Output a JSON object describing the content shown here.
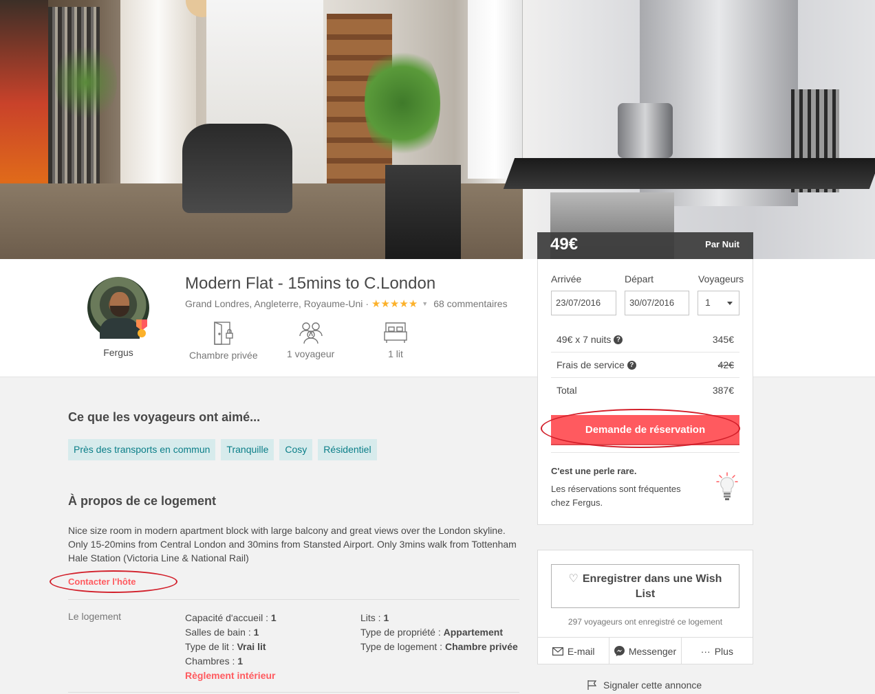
{
  "price": {
    "amount": "49€",
    "unit": "Par Nuit"
  },
  "host": {
    "name": "Fergus"
  },
  "listing": {
    "title": "Modern Flat - 15mins to C.London",
    "location": "Grand Londres, Angleterre, Royaume-Uni",
    "separator": "·",
    "rating_stars": "★★★★★",
    "rating_value": 5,
    "reviews": "68 commentaires"
  },
  "amenities": [
    {
      "icon": "private-room-icon",
      "label": "Chambre privée"
    },
    {
      "icon": "guests-icon",
      "label": "1 voyageur"
    },
    {
      "icon": "bed-icon",
      "label": "1 lit"
    }
  ],
  "booking": {
    "checkin_label": "Arrivée",
    "checkout_label": "Départ",
    "guests_label": "Voyageurs",
    "checkin_value": "23/07/2016",
    "checkout_value": "30/07/2016",
    "guests_value": "1",
    "rows": [
      {
        "label": "49€ x 7 nuits",
        "value": "345€",
        "help": "?"
      },
      {
        "label": "Frais de service",
        "value": "42€",
        "help": "?"
      },
      {
        "label": "Total",
        "value": "387€"
      }
    ],
    "button": "Demande de réservation",
    "pearl_title": "C'est une perle rare.",
    "pearl_text": "Les réservations sont fréquentes chez Fergus."
  },
  "wishlist": {
    "button": "Enregistrer dans une Wish List",
    "count_text": "297 voyageurs ont enregistré ce logement",
    "share": [
      {
        "icon": "email-icon",
        "label": "E-mail"
      },
      {
        "icon": "messenger-icon",
        "label": "Messenger"
      },
      {
        "icon": "more-dots-icon",
        "label": "Plus",
        "glyph": "···"
      }
    ],
    "report": "Signaler cette annonce"
  },
  "liked": {
    "title": "Ce que les voyageurs ont aimé...",
    "tags": [
      "Près des transports en commun",
      "Tranquille",
      "Cosy",
      "Résidentiel"
    ]
  },
  "about": {
    "title": "À propos de ce logement",
    "description": "Nice size room in modern apartment block with large balcony and great views over the London skyline. Only 15-20mins from Central London and 30mins from Stansted Airport. Only 3mins walk from Tottenham Hale Station (Victoria Line & National Rail)",
    "contact": "Contacter l'hôte"
  },
  "specs": {
    "label": "Le logement",
    "col1": [
      {
        "k": "Capacité d'accueil : ",
        "v": "1"
      },
      {
        "k": "Salles de bain : ",
        "v": "1"
      },
      {
        "k": "Type de lit : ",
        "v": "Vrai lit"
      },
      {
        "k": "Chambres : ",
        "v": "1"
      }
    ],
    "rules_link": "Règlement intérieur",
    "col2": [
      {
        "k": "Lits : ",
        "v": "1"
      },
      {
        "k": "Type de propriété : ",
        "v": "Appartement"
      },
      {
        "k": "Type de logement : ",
        "v": "Chambre privée"
      }
    ]
  },
  "colors": {
    "accent": "#ff5a5f",
    "tag_bg": "#d7ebec",
    "tag_text": "#0b7e88",
    "star": "#fcb12a",
    "annotation": "#d21f2a"
  }
}
